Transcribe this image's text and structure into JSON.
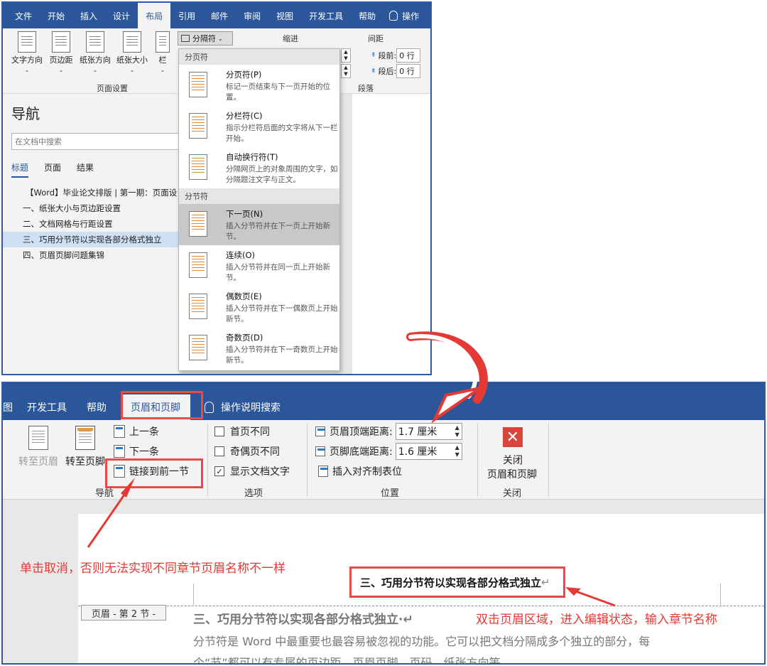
{
  "top": {
    "tabs": [
      "文件",
      "开始",
      "插入",
      "设计",
      "布局",
      "引用",
      "邮件",
      "审阅",
      "视图",
      "开发工具",
      "帮助"
    ],
    "active_tab": "布局",
    "tell_me": "操作",
    "tools": [
      "文字方向",
      "页边距",
      "纸张方向",
      "纸张大小",
      "栏"
    ],
    "group_page_setup": "页面设置",
    "breaks_button": "分隔符",
    "indent_label": "缩进",
    "spacing_label": "间距",
    "before_label": "段前:",
    "before_value": "0 行",
    "after_label": "段后:",
    "after_value": "0 行",
    "group_paragraph": "段落",
    "nav": {
      "title": "导航",
      "search_placeholder": "在文档中搜索",
      "tabs": [
        "标题",
        "页面",
        "结果"
      ],
      "items": [
        "【Word】毕业论文排版 | 第一期：页面设",
        "一、纸张大小与页边距设置",
        "二、文档网格与行距设置",
        "三、巧用分节符以实现各部分格式独立",
        "四、页眉页脚问题集锦"
      ]
    },
    "dropdown": {
      "section_page": "分页符",
      "section_section": "分节符",
      "items": [
        {
          "title": "分页符(P)",
          "desc": "标记一页结束与下一页开始的位置。"
        },
        {
          "title": "分栏符(C)",
          "desc": "指示分栏符后面的文字将从下一栏开始。"
        },
        {
          "title": "自动换行符(T)",
          "desc": "分隔网页上的对象周围的文字，如分隔题注文字与正文。"
        },
        {
          "title": "下一页(N)",
          "desc": "插入分节符并在下一页上开始新节。"
        },
        {
          "title": "连续(O)",
          "desc": "插入分节符并在同一页上开始新节。"
        },
        {
          "title": "偶数页(E)",
          "desc": "插入分节符并在下一偶数页上开始新节。"
        },
        {
          "title": "奇数页(D)",
          "desc": "插入分节符并在下一奇数页上开始新节。"
        }
      ]
    }
  },
  "bottom": {
    "tab_cut": "图",
    "tabs": [
      "开发工具",
      "帮助",
      "页眉和页脚",
      "操作说明搜索"
    ],
    "active_tab": "页眉和页脚",
    "goto_header": "转至页眉",
    "goto_footer": "转至页脚",
    "previous": "上一条",
    "next": "下一条",
    "link_previous": "链接到前一节",
    "group_nav": "导航",
    "diff_first": "首页不同",
    "diff_odd_even": "奇偶页不同",
    "show_doc_text": "显示文档文字",
    "group_options": "选项",
    "header_top_label": "页眉顶端距离:",
    "header_top_value": "1.7 厘米",
    "footer_bottom_label": "页脚底端距离:",
    "footer_bottom_value": "1.6 厘米",
    "insert_align_tab": "插入对齐制表位",
    "group_position": "位置",
    "close_line1": "关闭",
    "close_line2": "页眉和页脚",
    "group_close": "关闭",
    "annotation_left": "单击取消，否则无法实现不同章节页眉名称不一样",
    "annotation_right": "双击页眉区域，进入编辑状态，输入章节名称",
    "header_text": "三、巧用分节符以实现各部分格式独立",
    "header_tag": "页眉 - 第 2 节 -",
    "body_heading": "三、巧用分节符以实现各部分格式独立·",
    "body_line1": "分节符是 Word 中最重要也最容易被忽视的功能。它可以把文档分隔成多个独立的部分，每",
    "body_line2": "个“节”都可以有专属的页边距、页眉页脚、页码、纸张方向等。"
  },
  "colors": {
    "ribbon_blue": "#2b579a",
    "annotation_red": "#e53935"
  }
}
